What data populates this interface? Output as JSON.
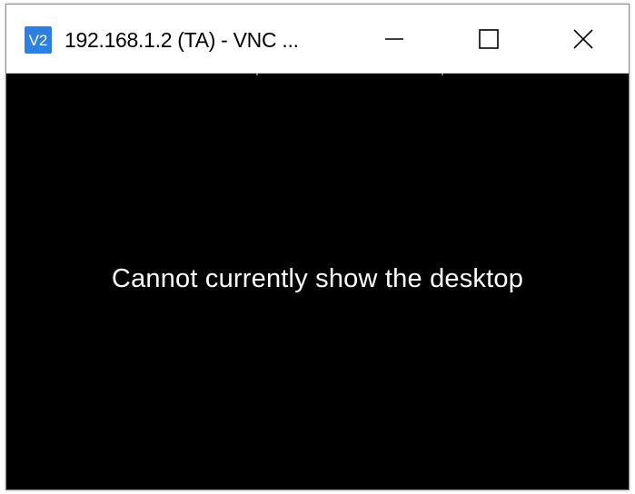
{
  "window": {
    "title": "192.168.1.2 (TA) - VNC ...",
    "app_icon": "vnc-viewer-icon",
    "controls": {
      "minimize": "minimize-icon",
      "maximize": "maximize-icon",
      "close": "close-icon"
    }
  },
  "viewer": {
    "status_message": "Cannot currently show the desktop"
  },
  "colors": {
    "titlebar_background": "#ffffff",
    "viewer_background": "#000000",
    "message_text": "#ffffff",
    "app_icon": "#2d7fe0"
  }
}
